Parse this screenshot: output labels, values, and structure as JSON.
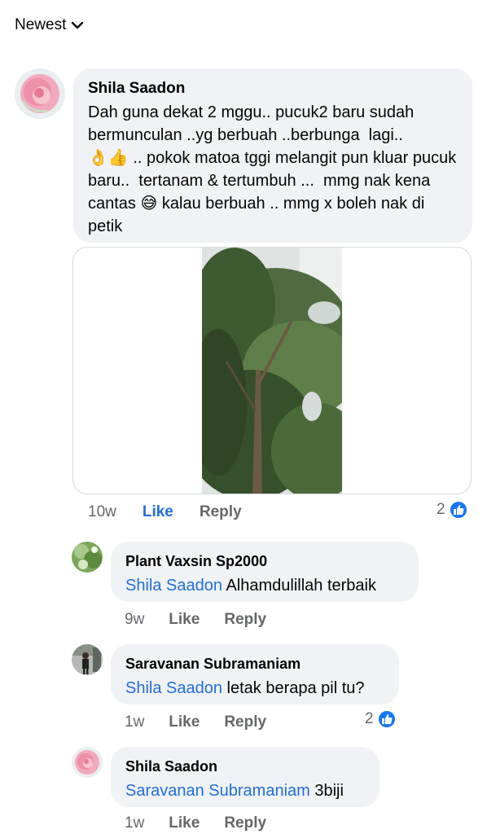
{
  "sort": {
    "label": "Newest",
    "icon": "chevron-down-icon"
  },
  "colors": {
    "mention": "#216fdb",
    "bubble": "#f0f2f5",
    "muted": "#65676b",
    "like_badge": "#1877f2"
  },
  "comments": [
    {
      "author": "Shila Saadon",
      "text": "Dah guna dekat 2 mggu.. pucuk2 baru sudah bermunculan ..yg berbuah ..berbunga  lagi..\n👌👍 .. pokok matoa tggi melangit pun kluar pucuk baru..  tertanam & tertumbuh ...  mmg nak kena cantas 😅 kalau berbuah .. mmg x boleh nak di petik",
      "time": "10w",
      "like_label": "Like",
      "reply_label": "Reply",
      "reaction_count": "2",
      "reaction_icon": "thumbs-up-icon",
      "attachment": "tree-photo"
    }
  ],
  "replies": [
    {
      "author": "Plant Vaxsin Sp2000",
      "mention": "Shila Saadon",
      "text": " Alhamdulillah terbaik",
      "time": "9w",
      "like_label": "Like",
      "reply_label": "Reply"
    },
    {
      "author": "Saravanan Subramaniam",
      "mention": "Shila Saadon",
      "text": " letak berapa pil tu?",
      "time": "1w",
      "like_label": "Like",
      "reply_label": "Reply",
      "reaction_count": "2",
      "reaction_icon": "thumbs-up-icon"
    },
    {
      "author": "Shila Saadon",
      "mention": "Saravanan Subramaniam",
      "text": " 3biji",
      "time": "1w",
      "like_label": "Like",
      "reply_label": "Reply"
    }
  ]
}
